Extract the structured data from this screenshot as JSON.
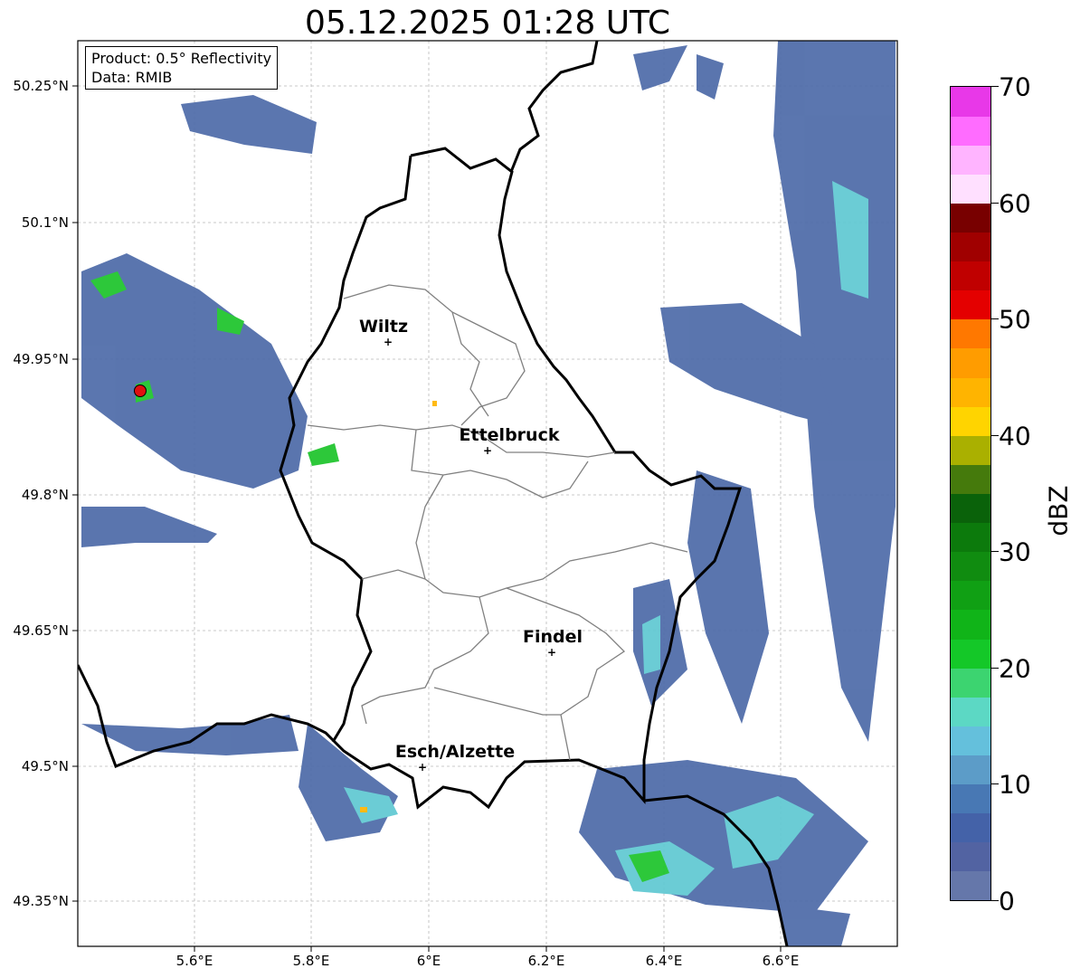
{
  "title": "05.12.2025 01:28 UTC",
  "info_box": {
    "product": "Product: 0.5° Reflectivity",
    "data_source": "Data: RMIB"
  },
  "cities": [
    {
      "name": "Wiltz",
      "lon": 5.93,
      "lat": 49.966
    },
    {
      "name": "Ettelbruck",
      "lon": 6.1,
      "lat": 49.847
    },
    {
      "name": "Findel",
      "lon": 6.21,
      "lat": 49.627
    },
    {
      "name": "Esch/Alzette",
      "lon": 5.99,
      "lat": 49.5
    }
  ],
  "radar_site": {
    "lon": 5.506,
    "lat": 49.914
  },
  "map_extent": {
    "lon": [
      5.4,
      6.8
    ],
    "lat": [
      49.3,
      50.3
    ]
  },
  "lat_ticks": [
    "50.25°N",
    "50.1°N",
    "49.95°N",
    "49.8°N",
    "49.65°N",
    "49.5°N",
    "49.35°N"
  ],
  "lon_ticks": [
    "5.6°E",
    "5.8°E",
    "6°E",
    "6.2°E",
    "6.4°E",
    "6.6°E"
  ],
  "colorbar": {
    "label": "dBZ",
    "min": 0,
    "max": 70,
    "tick_labels": [
      "0",
      "10",
      "20",
      "30",
      "40",
      "50",
      "60",
      "70"
    ],
    "colors": [
      "#6577aa",
      "#5263a2",
      "#4462a8",
      "#4878b4",
      "#5c9cc8",
      "#64c0dc",
      "#5cd8c4",
      "#3cd470",
      "#14c828",
      "#10b418",
      "#10a014",
      "#108c10",
      "#0c7a0c",
      "#0a620a",
      "#457a0c",
      "#aab000",
      "#ffd400",
      "#ffb400",
      "#ff9c00",
      "#ff7800",
      "#e40000",
      "#c00000",
      "#a00000",
      "#780000",
      "#ffe0ff",
      "#ffb4ff",
      "#ff6cff",
      "#e838e8"
    ]
  }
}
